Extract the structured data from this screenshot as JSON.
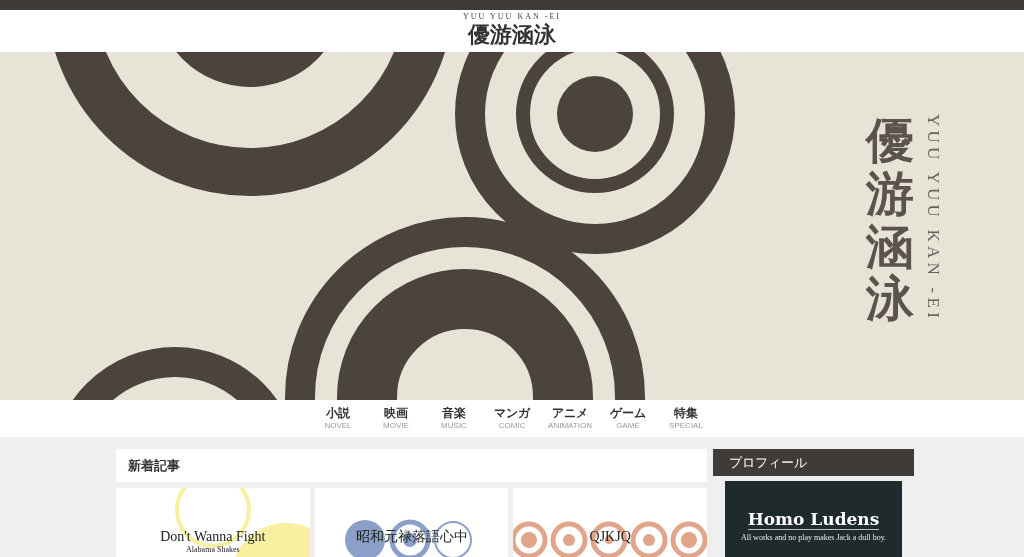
{
  "header": {
    "romaji": "YUU YUU KAN -EI",
    "title": "優游涵泳"
  },
  "hero": {
    "title": "優游涵泳",
    "romaji": "YUU YUU KAN -EI"
  },
  "nav": [
    {
      "label": "小説",
      "sub": "NOVEL"
    },
    {
      "label": "映画",
      "sub": "MOVIE"
    },
    {
      "label": "音楽",
      "sub": "MUSIC"
    },
    {
      "label": "マンガ",
      "sub": "COMIC"
    },
    {
      "label": "アニメ",
      "sub": "ANIMATION"
    },
    {
      "label": "ゲーム",
      "sub": "GAME"
    },
    {
      "label": "特集",
      "sub": "SPECIAL"
    }
  ],
  "main": {
    "heading": "新着記事",
    "cards": [
      {
        "kind": "rings",
        "title": "Don't Wanna Fight",
        "subtitle": "Alabama Shakes"
      },
      {
        "kind": "dots",
        "title": "昭和元禄落語心中"
      },
      {
        "kind": "targets",
        "title": "QJKJQ"
      }
    ]
  },
  "sidebar": {
    "heading": "プロフィール",
    "profile": {
      "title": "Homo Ludens",
      "tagline": "All works and no play makes Jack a dull boy."
    }
  }
}
